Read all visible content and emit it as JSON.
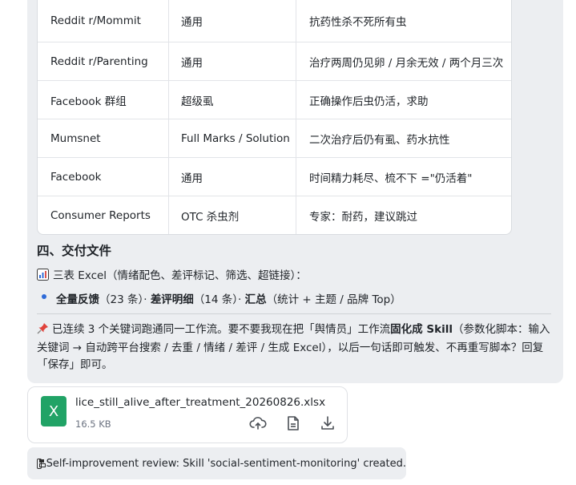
{
  "table": {
    "rows": [
      [
        "Reddit r/Mommit",
        "通用",
        "抗药性杀不死所有虫"
      ],
      [
        "Reddit r/Parenting",
        "通用",
        "治疗两周仍见卵 / 月余无效 / 两个月三次"
      ],
      [
        "Facebook 群组",
        "超级虱",
        "正确操作后虫仍活，求助"
      ],
      [
        "Mumsnet",
        "Full Marks / Solution",
        "二次治疗后仍有虱、药水抗性"
      ],
      [
        "Facebook",
        "通用",
        "时间精力耗尽、梳不下 =\"仍活着\""
      ],
      [
        "Consumer Reports",
        "OTC 杀虫剂",
        "专家：耐药，建议跳过"
      ]
    ]
  },
  "section": {
    "heading": "四、交付文件",
    "excel_icon": "bar-chart-icon",
    "excel_line": "三表 Excel（情绪配色、差评标记、筛选、超链接）：",
    "bullet": {
      "b1": "全量反馈",
      "t1": "（23 条）· ",
      "b2": "差评明细",
      "t2": "（14 条）· ",
      "b3": "汇总",
      "t3": "（统计 + 主题 / 品牌 Top）"
    }
  },
  "note": {
    "icon": "pushpin-icon",
    "pre": "已连续 3 个关键词跑通同一工作流。要不要我现在把「舆情员」工作流",
    "bold": "固化成 Skill",
    "post": "（参数化脚本：输入关键词 → 自动跨平台搜索 / 去重 / 情绪 / 差评 / 生成 Excel），以后一句话即可触发、不再重写脚本？回复「保存」即可。"
  },
  "file": {
    "icon_letter": "X",
    "name": "lice_still_alive_after_treatment_20260826.xlsx",
    "size": "16.5 KB"
  },
  "review": {
    "icon": "floppy-disk-icon",
    "text": "Self-improvement review: Skill 'social-sentiment-monitoring' created."
  },
  "colors": {
    "bubble_bg": "#eceef1",
    "excel_green": "#21a366",
    "bullet_blue": "#2f6bd8"
  }
}
